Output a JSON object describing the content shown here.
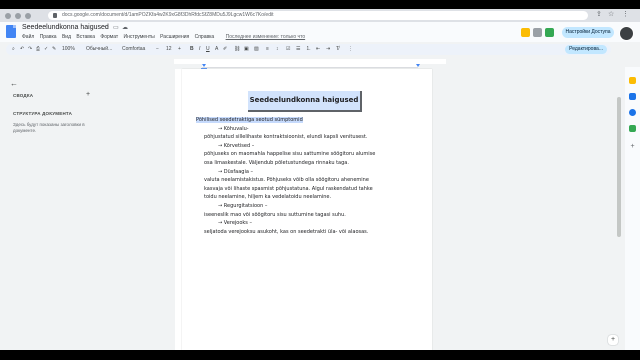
{
  "browser": {
    "url": "docs.google.com/document/d/1amPOZKfa4w2K9xG8f3DhRfdcSfZ8MDu5J9Lgcw1W6c7Ko/edit"
  },
  "doc": {
    "title": "Seedeelundkonna haigused",
    "menu": [
      "Файл",
      "Правка",
      "Вид",
      "Вставка",
      "Формат",
      "Инструменты",
      "Расширения",
      "Справка"
    ],
    "last_edit": "Последнее изменение: только что",
    "share_label": "Настройки Доступа",
    "edit_mode": "Редактирова..."
  },
  "toolbar": {
    "zoom": "100%",
    "style": "Обычный...",
    "font": "Comfortaa",
    "font_size": "12"
  },
  "outline": {
    "summary_label": "СВОДКА",
    "structure_label": "СТРУКТУРА ДОКУМЕНТА",
    "hint": "Здесь будут показаны заголовки в документе."
  },
  "page": {
    "heading": "Seedeelundkonna haigused",
    "lines": [
      {
        "text": "Põhilised seedetraktiga seotud sümptomid",
        "style": "highlight"
      },
      {
        "text": "→  Kõhuvalu-",
        "style": "sub"
      },
      {
        "text": "põhjustatud sillelihaste kontraktsioonist, elundi kapsli venitusest.",
        "style": "body"
      },
      {
        "text": "→  Kõrvetised –",
        "style": "sub"
      },
      {
        "text": "põhjuseks on maomahla happelise sisu sattumine söögitoru alumise",
        "style": "body"
      },
      {
        "text": "osa limaskestale. Väljendub põletustundega rinnaku taga.",
        "style": "body2"
      },
      {
        "text": "→  Düsfaagia –",
        "style": "sub"
      },
      {
        "text": "valuta neelamistakistus. Põhjuseks võib olla söögitoru ahenemine",
        "style": "body"
      },
      {
        "text": "kasvaja või lihaste spasmist põhjustatuna. Algul raskendatud tahke",
        "style": "body2"
      },
      {
        "text": "toidu neelamine, hiljem ka vedelatoidu neelamine.",
        "style": "body2"
      },
      {
        "text": "→  Regurgitatsioon –",
        "style": "sub"
      },
      {
        "text": "iseeneslik mao või söögitoru sisu suttumine tagasi suhu.",
        "style": "body"
      },
      {
        "text": "→  Verejooks –",
        "style": "sub"
      },
      {
        "text": "seljatoda verejooksu asukoht, kas on seedetrakti üla- või alaosas.",
        "style": "body"
      }
    ]
  },
  "colors": {
    "heading_bg": "#d2e3fc",
    "highlight": "#c6dafc",
    "share_bg": "#c2e7ff",
    "docs_blue": "#4285f4"
  }
}
